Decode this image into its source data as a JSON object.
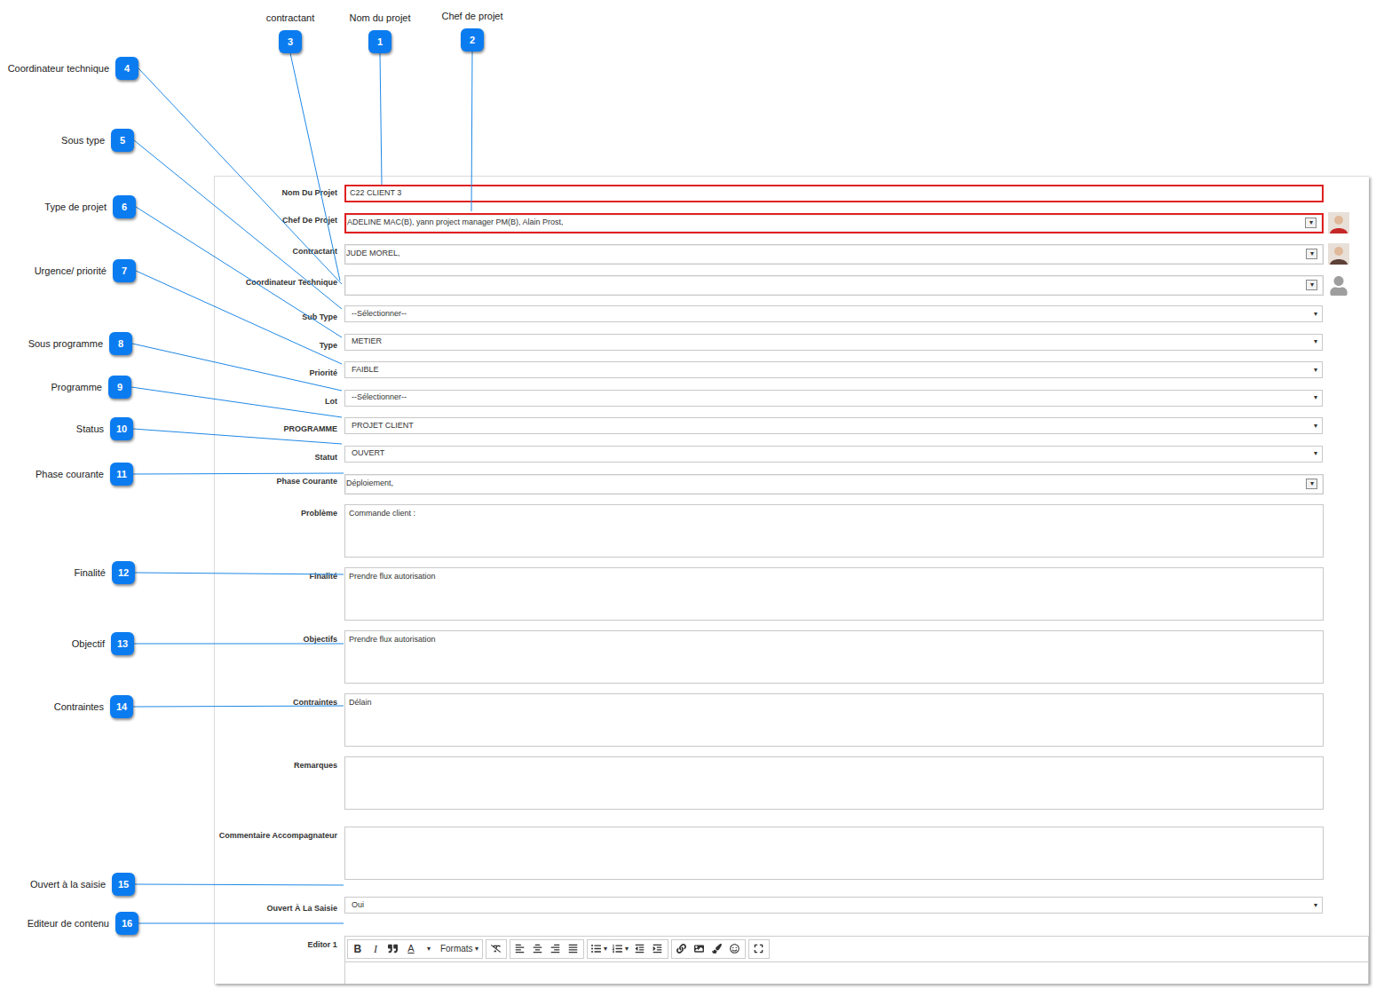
{
  "callouts": [
    {
      "number": "1",
      "label": "Nom du projet"
    },
    {
      "number": "2",
      "label": "Chef de projet"
    },
    {
      "number": "3",
      "label": "contractant"
    },
    {
      "number": "4",
      "label": "Coordinateur technique"
    },
    {
      "number": "5",
      "label": "Sous type"
    },
    {
      "number": "6",
      "label": "Type de projet"
    },
    {
      "number": "7",
      "label": "Urgence/ priorité"
    },
    {
      "number": "8",
      "label": "Sous programme"
    },
    {
      "number": "9",
      "label": "Programme"
    },
    {
      "number": "10",
      "label": "Status"
    },
    {
      "number": "11",
      "label": "Phase courante"
    },
    {
      "number": "12",
      "label": "Finalité"
    },
    {
      "number": "13",
      "label": "Objectif"
    },
    {
      "number": "14",
      "label": "Contraintes"
    },
    {
      "number": "15",
      "label": "Ouvert à la saisie"
    },
    {
      "number": "16",
      "label": "Editeur de contenu"
    }
  ],
  "caret": "▾",
  "sections": [
    {
      "fields": [
        {
          "label": "Nom Du Projet",
          "kind": "text",
          "value": "C22 CLIENT 3",
          "required": true
        },
        {
          "label": "Chef De Projet",
          "kind": "multi",
          "value": "ADELINE MAC(B), yann project manager PM(B), Alain Prost,",
          "required": true,
          "avatar": "photo",
          "color": "#c62828"
        },
        {
          "label": "Contractant",
          "kind": "multi",
          "value": "JUDE MOREL,",
          "required": false,
          "avatar": "photo",
          "color": "#5d4037"
        },
        {
          "label": "Coordinateur Technique",
          "kind": "multi",
          "value": "",
          "required": false,
          "avatar": "placeholder",
          "color": "#9e9e9e"
        },
        {
          "label": "Sub Type",
          "kind": "select",
          "value": "--Sélectionner--",
          "required": false
        },
        {
          "label": "Type",
          "kind": "select",
          "value": "METIER",
          "required": false
        },
        {
          "label": "Priorité",
          "kind": "select",
          "value": "FAIBLE",
          "required": false
        },
        {
          "label": "Lot",
          "kind": "select",
          "value": "--Sélectionner--",
          "required": false
        },
        {
          "label": "PROGRAMME",
          "kind": "select",
          "value": "PROJET CLIENT",
          "required": false
        },
        {
          "label": "Statut",
          "kind": "select",
          "value": "OUVERT",
          "required": false
        },
        {
          "label": "Phase Courante",
          "kind": "multi",
          "value": "Déploiement,",
          "required": false,
          "avatar": "none",
          "color": "#ffffff"
        },
        {
          "label": "Problème",
          "kind": "textarea",
          "value": "Commande client :",
          "required": false
        },
        {
          "label": "Finalité",
          "kind": "textarea",
          "value": "Prendre flux autorisation",
          "required": false
        },
        {
          "label": "Objectifs",
          "kind": "textarea",
          "value": "Prendre flux autorisation",
          "required": false
        },
        {
          "label": "Contraintes",
          "kind": "textarea",
          "value": "Délain",
          "required": false
        },
        {
          "label": "Remarques",
          "kind": "textarea",
          "value": "",
          "required": false
        }
      ]
    },
    {
      "fields": [
        {
          "label": "Commentaire Accompagnateur",
          "kind": "textarea",
          "value": "",
          "required": false
        },
        {
          "label": "Ouvert À La Saisie",
          "kind": "select",
          "value": "Oui",
          "required": false
        }
      ]
    }
  ],
  "editor": {
    "label": "Editor 1",
    "bold": "B",
    "italic": "I",
    "color": "A",
    "formats": "Formats",
    "caret": "▾"
  }
}
